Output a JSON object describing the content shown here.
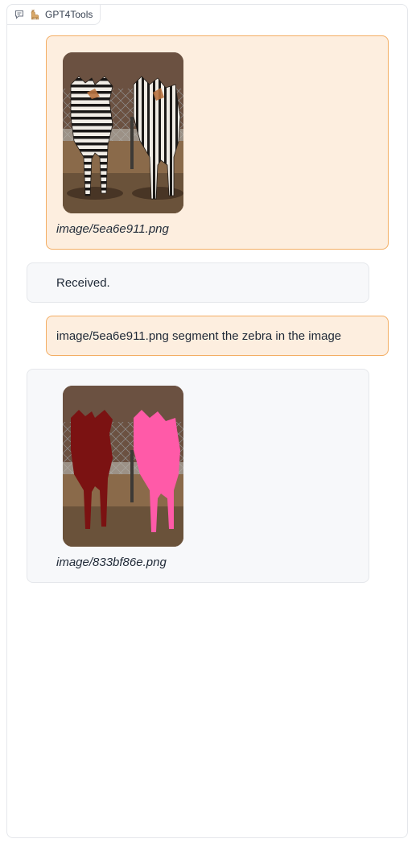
{
  "app": {
    "label": "GPT4Tools",
    "label_icon": "chat-icon",
    "brand_icon": "llama-emoji-icon"
  },
  "colors": {
    "user_bg": "#fdeedf",
    "user_border": "#f3ad63",
    "bot_bg": "#f7f8fa",
    "mask_left": "#7b1212",
    "mask_right": "#ff5aa8"
  },
  "messages": [
    {
      "role": "user",
      "type": "image",
      "caption": "image/5ea6e911.png",
      "image": "zebras-photo"
    },
    {
      "role": "bot",
      "type": "text",
      "text": "Received."
    },
    {
      "role": "user",
      "type": "text",
      "text": "image/5ea6e911.png segment the zebra in the image"
    },
    {
      "role": "bot",
      "type": "image",
      "caption": "image/833bf86e.png",
      "image": "zebras-segmentation-mask"
    }
  ]
}
